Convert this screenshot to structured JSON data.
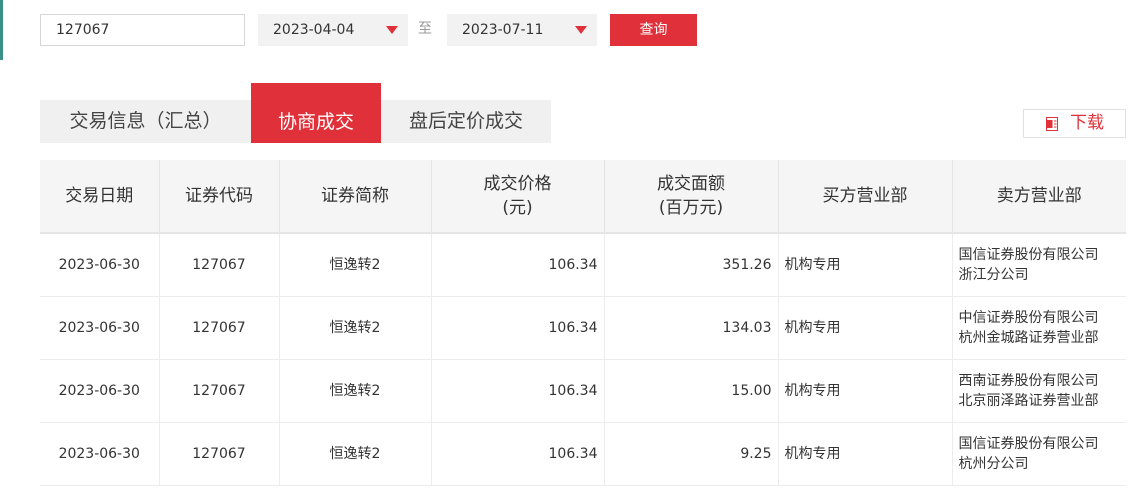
{
  "search": {
    "code_value": "127067",
    "start_date": "2023-04-04",
    "to_label": "至",
    "end_date": "2023-07-11",
    "query_label": "查询"
  },
  "tabs": [
    {
      "label": "交易信息（汇总）",
      "active": false
    },
    {
      "label": "协商成交",
      "active": true
    },
    {
      "label": "盘后定价成交",
      "active": false
    }
  ],
  "download_label": "下载",
  "colors": {
    "accent": "#e0313a",
    "header_bg": "#f5f5f5",
    "tab_bg": "#f0f0f0"
  },
  "icons": {
    "select_arrow": "caret-down-icon",
    "download": "document-icon"
  },
  "table": {
    "headers": [
      [
        "交易日期"
      ],
      [
        "证券代码"
      ],
      [
        "证券简称"
      ],
      [
        "成交价格",
        "(元)"
      ],
      [
        "成交面额",
        "(百万元)"
      ],
      [
        "买方营业部"
      ],
      [
        "卖方营业部"
      ]
    ],
    "rows": [
      [
        "2023-06-30",
        "127067",
        "恒逸转2",
        "106.34",
        "351.26",
        "机构专用",
        "国信证券股份有限公司",
        "浙江分公司"
      ],
      [
        "2023-06-30",
        "127067",
        "恒逸转2",
        "106.34",
        "134.03",
        "机构专用",
        "中信证券股份有限公司",
        "杭州金城路证券营业部"
      ],
      [
        "2023-06-30",
        "127067",
        "恒逸转2",
        "106.34",
        "15.00",
        "机构专用",
        "西南证券股份有限公司",
        "北京丽泽路证券营业部"
      ],
      [
        "2023-06-30",
        "127067",
        "恒逸转2",
        "106.34",
        "9.25",
        "机构专用",
        "国信证券股份有限公司",
        "杭州分公司"
      ]
    ]
  }
}
